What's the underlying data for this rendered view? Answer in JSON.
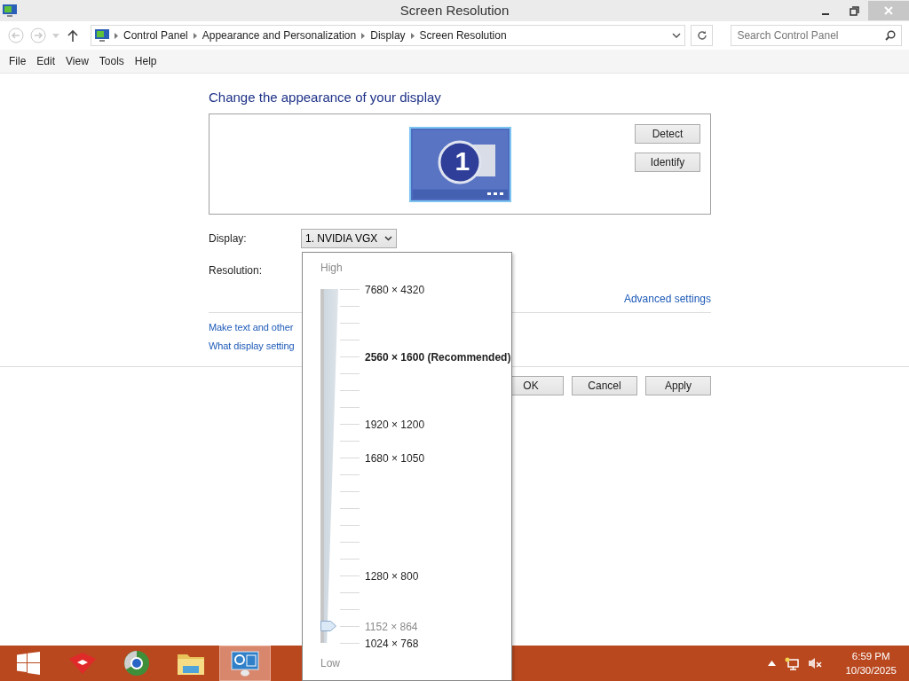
{
  "window": {
    "title": "Screen Resolution"
  },
  "address": {
    "breadcrumbs": [
      "Control Panel",
      "Appearance and Personalization",
      "Display",
      "Screen Resolution"
    ],
    "search_placeholder": "Search Control Panel"
  },
  "menu": [
    "File",
    "Edit",
    "View",
    "Tools",
    "Help"
  ],
  "heading": "Change the appearance of your display",
  "monitor": {
    "number": "1"
  },
  "side_buttons": [
    "Detect",
    "Identify"
  ],
  "display": {
    "label": "Display:",
    "value": "1. NVIDIA VGX"
  },
  "resolution": {
    "label": "Resolution:"
  },
  "advanced_link": "Advanced settings",
  "links": [
    "Make text and other",
    "What display setting"
  ],
  "buttons": [
    "OK",
    "Cancel",
    "Apply"
  ],
  "resolution_popup": {
    "high": "High",
    "low": "Low",
    "ticks": [
      {
        "kind": "labeled",
        "label": "7680 × 4320",
        "recommended": false,
        "selected": false
      },
      {
        "kind": "plain",
        "selected": false
      },
      {
        "kind": "plain",
        "selected": false
      },
      {
        "kind": "plain",
        "selected": false
      },
      {
        "kind": "labeled",
        "label": "2560 × 1600 (Recommended)",
        "recommended": true,
        "selected": false
      },
      {
        "kind": "plain",
        "selected": false
      },
      {
        "kind": "plain",
        "selected": false
      },
      {
        "kind": "plain",
        "selected": false
      },
      {
        "kind": "labeled",
        "label": "1920 × 1200",
        "recommended": false,
        "selected": false
      },
      {
        "kind": "plain",
        "selected": false
      },
      {
        "kind": "labeled",
        "label": "1680 × 1050",
        "recommended": false,
        "selected": false
      },
      {
        "kind": "plain",
        "selected": false
      },
      {
        "kind": "plain",
        "selected": false
      },
      {
        "kind": "plain",
        "selected": false
      },
      {
        "kind": "plain",
        "selected": false
      },
      {
        "kind": "plain",
        "selected": false
      },
      {
        "kind": "plain",
        "selected": false
      },
      {
        "kind": "labeled",
        "label": "1280 × 800",
        "recommended": false,
        "selected": false
      },
      {
        "kind": "plain",
        "selected": false
      },
      {
        "kind": "plain",
        "selected": false
      },
      {
        "kind": "labeled",
        "label": "1152 × 864",
        "recommended": false,
        "selected": true
      },
      {
        "kind": "labeled",
        "label": "1024 × 768",
        "recommended": false,
        "selected": false
      }
    ]
  },
  "taskbar": {
    "apps": [
      {
        "kind": "start",
        "selected": false
      },
      {
        "kind": "red",
        "selected": false
      },
      {
        "kind": "globe",
        "selected": false
      },
      {
        "kind": "folder",
        "selected": false
      },
      {
        "kind": "control",
        "selected": true
      }
    ],
    "time": "6:59 PM",
    "date": "10/30/2025"
  }
}
